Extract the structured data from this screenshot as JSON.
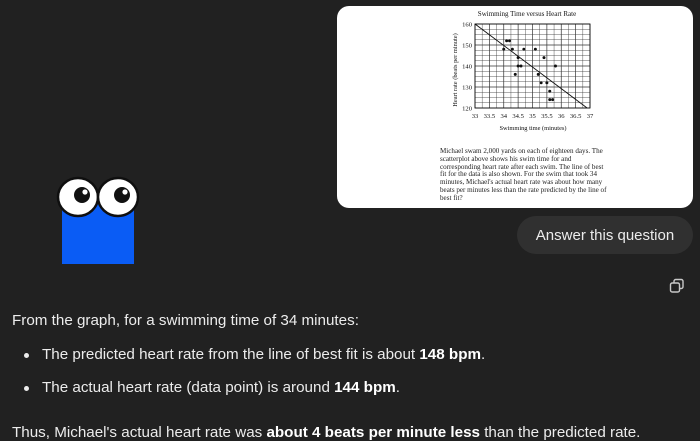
{
  "image_card": {
    "chart_data": {
      "type": "scatter",
      "title": "Swimming Time versus Heart Rate",
      "xlabel": "Swimming time (minutes)",
      "ylabel": "Heart rate (beats per minute)",
      "xlim": [
        33,
        37
      ],
      "ylim": [
        120,
        160
      ],
      "x_ticks": [
        "33",
        "33.5",
        "34",
        "34.5",
        "35",
        "35.5",
        "36",
        "36.5",
        "37"
      ],
      "y_ticks": [
        "120",
        "130",
        "140",
        "150",
        "160"
      ],
      "grid": true,
      "points": [
        {
          "x": 34.0,
          "y": 148
        },
        {
          "x": 34.1,
          "y": 152
        },
        {
          "x": 34.2,
          "y": 152
        },
        {
          "x": 34.3,
          "y": 148
        },
        {
          "x": 34.5,
          "y": 144
        },
        {
          "x": 34.6,
          "y": 140
        },
        {
          "x": 34.7,
          "y": 148
        },
        {
          "x": 34.5,
          "y": 140
        },
        {
          "x": 34.4,
          "y": 136
        },
        {
          "x": 35.1,
          "y": 148
        },
        {
          "x": 35.2,
          "y": 136
        },
        {
          "x": 35.3,
          "y": 132
        },
        {
          "x": 35.4,
          "y": 144
        },
        {
          "x": 35.5,
          "y": 132
        },
        {
          "x": 35.6,
          "y": 128
        },
        {
          "x": 35.6,
          "y": 124
        },
        {
          "x": 35.7,
          "y": 124
        },
        {
          "x": 35.8,
          "y": 140
        }
      ],
      "best_fit_line": {
        "x1": 33,
        "y1": 160,
        "x2": 36.9,
        "y2": 120
      }
    },
    "problem_text": "Michael swam 2,000 yards on each of eighteen days. The scatterplot above shows his swim time for and corresponding heart rate after each swim. The line of best fit for the data is also shown. For the swim that took 34 minutes, Michael's actual heart rate was about how many beats per minutes less than the rate predicted by the line of best fit?"
  },
  "user_prompt": "Answer this question",
  "copy_icon": "copy-icon",
  "answer": {
    "intro": "From the graph, for a swimming time of 34 minutes:",
    "bullets": [
      {
        "before": "The predicted heart rate from the line of best fit is about ",
        "bold": "148 bpm",
        "after": "."
      },
      {
        "before": "The actual heart rate (data point) is around ",
        "bold": "144 bpm",
        "after": "."
      }
    ],
    "conclusion": {
      "before": "Thus, Michael's actual heart rate was ",
      "bold": "about 4 beats per minute less",
      "after": " than the predicted rate."
    }
  },
  "colors": {
    "background": "#212121",
    "pill": "#303030",
    "mascot_body": "#0a5cf5"
  }
}
